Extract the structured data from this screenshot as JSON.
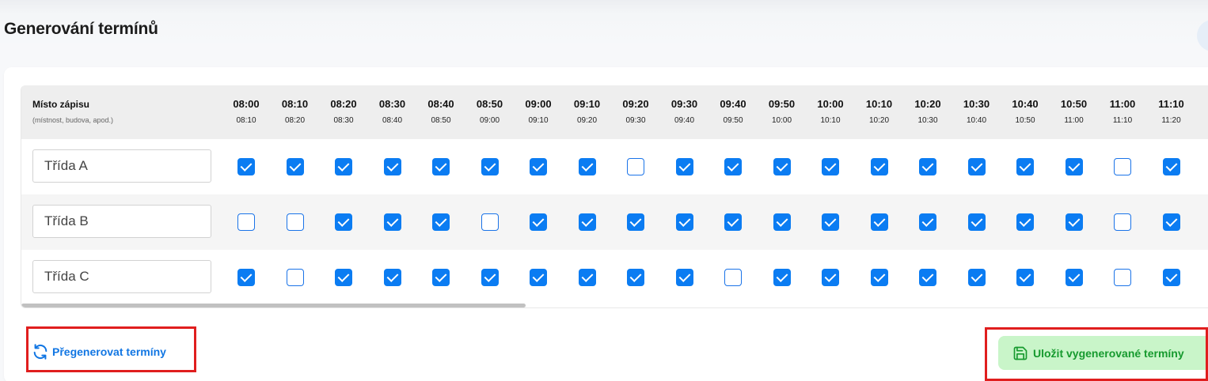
{
  "page": {
    "title": "Generování termínů"
  },
  "table": {
    "place_header": "Místo zápisu",
    "place_hint": "(místnost, budova, apod.)",
    "slots": [
      {
        "start": "08:00",
        "end": "08:10"
      },
      {
        "start": "08:10",
        "end": "08:20"
      },
      {
        "start": "08:20",
        "end": "08:30"
      },
      {
        "start": "08:30",
        "end": "08:40"
      },
      {
        "start": "08:40",
        "end": "08:50"
      },
      {
        "start": "08:50",
        "end": "09:00"
      },
      {
        "start": "09:00",
        "end": "09:10"
      },
      {
        "start": "09:10",
        "end": "09:20"
      },
      {
        "start": "09:20",
        "end": "09:30"
      },
      {
        "start": "09:30",
        "end": "09:40"
      },
      {
        "start": "09:40",
        "end": "09:50"
      },
      {
        "start": "09:50",
        "end": "10:00"
      },
      {
        "start": "10:00",
        "end": "10:10"
      },
      {
        "start": "10:10",
        "end": "10:20"
      },
      {
        "start": "10:20",
        "end": "10:30"
      },
      {
        "start": "10:30",
        "end": "10:40"
      },
      {
        "start": "10:40",
        "end": "10:50"
      },
      {
        "start": "10:50",
        "end": "11:00"
      },
      {
        "start": "11:00",
        "end": "11:10"
      },
      {
        "start": "11:10",
        "end": "11:20"
      }
    ],
    "rows": [
      {
        "place": "Třída A",
        "checked": [
          true,
          true,
          true,
          true,
          true,
          true,
          true,
          true,
          false,
          true,
          true,
          true,
          true,
          true,
          true,
          true,
          true,
          true,
          false,
          true
        ]
      },
      {
        "place": "Třída B",
        "checked": [
          false,
          false,
          true,
          true,
          true,
          false,
          true,
          true,
          true,
          true,
          true,
          true,
          true,
          true,
          true,
          true,
          true,
          true,
          false,
          true
        ]
      },
      {
        "place": "Třída C",
        "checked": [
          true,
          false,
          true,
          true,
          true,
          true,
          true,
          true,
          true,
          true,
          false,
          true,
          true,
          true,
          true,
          true,
          true,
          true,
          false,
          true
        ]
      }
    ]
  },
  "actions": {
    "regenerate_label": "Přegenerovat termíny",
    "regenerate_icon": "refresh-icon",
    "save_label": "Uložit vygenerované termíny",
    "save_icon": "floppy-disk-icon"
  },
  "colors": {
    "accent": "#0b7cf2",
    "save_bg": "#c9f5c9",
    "save_text": "#169a2e",
    "highlight": "#e01e1e"
  }
}
